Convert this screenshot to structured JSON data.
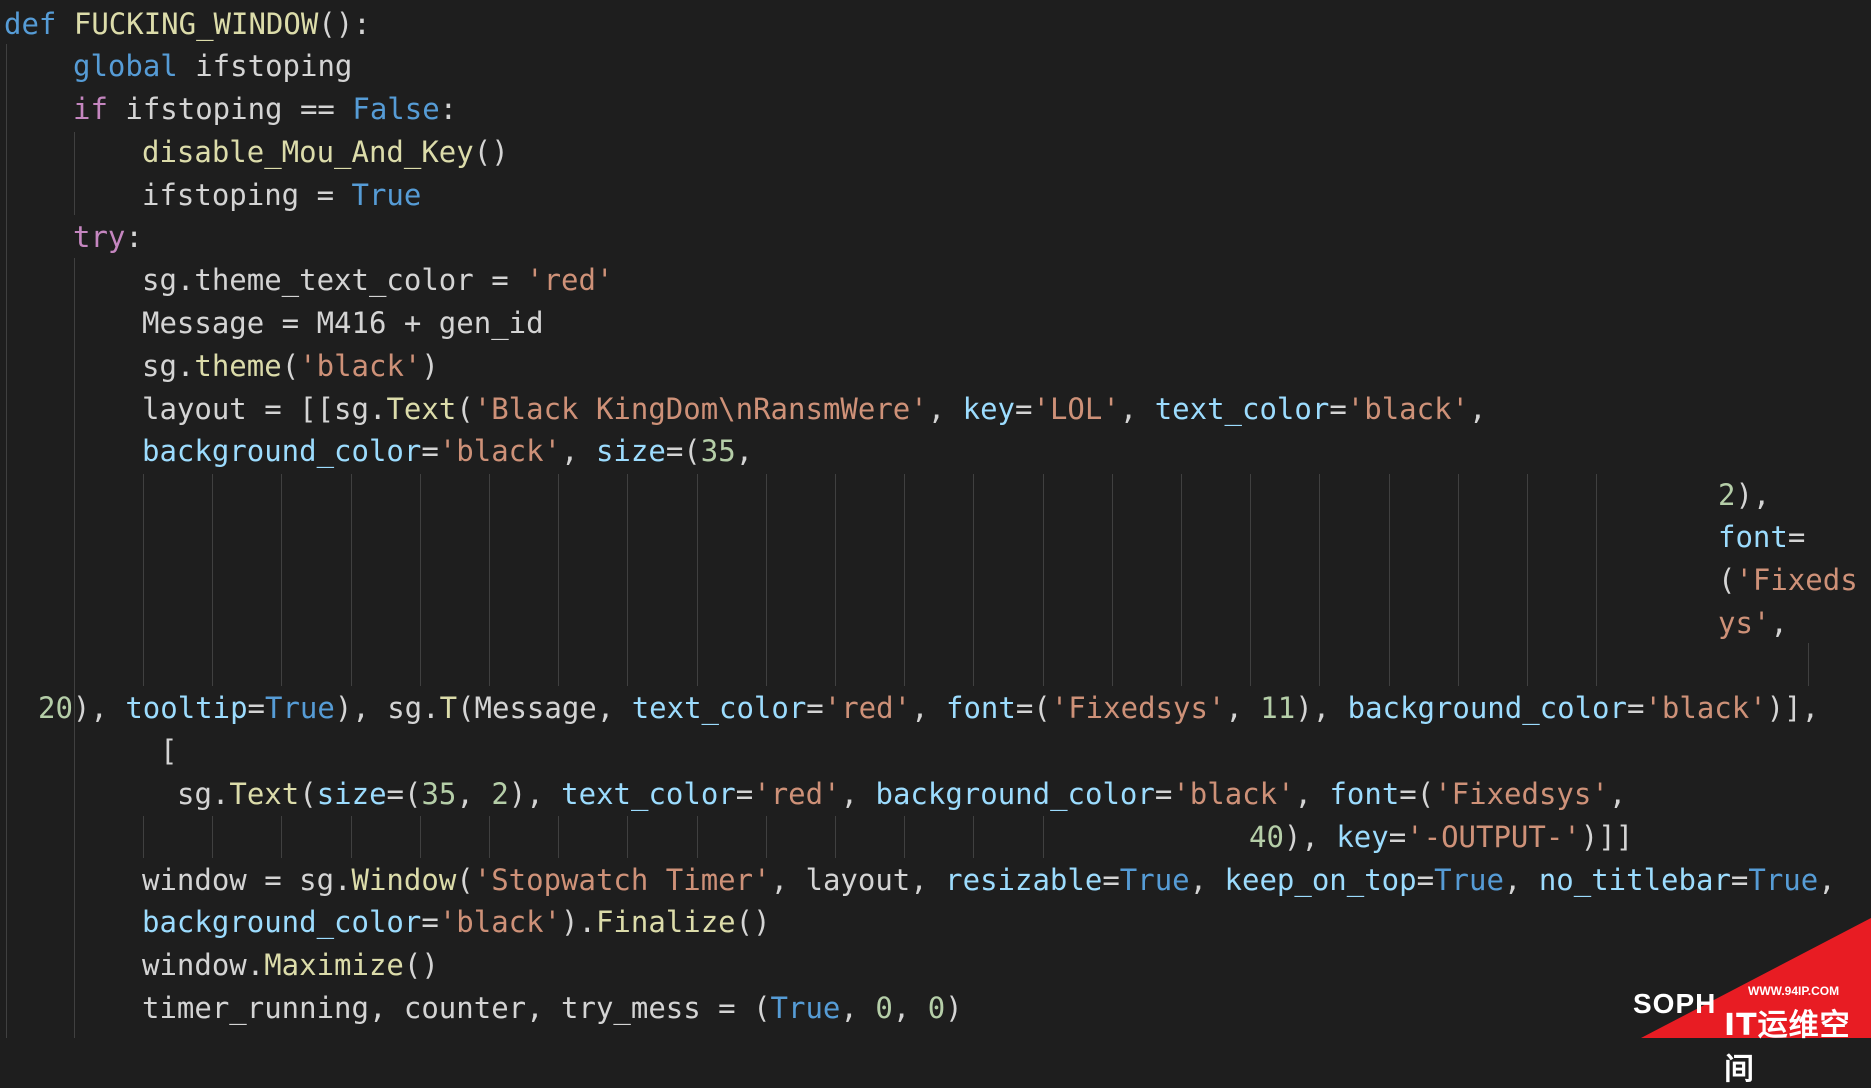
{
  "colors": {
    "background": "#1e1e1e",
    "keyword": "#569cd6",
    "control": "#c586c0",
    "function": "#dcdcaa",
    "string": "#ce9178",
    "number": "#b5cea8",
    "parameter": "#9cdcfe",
    "text": "#d4d4d4",
    "watermark": "#e81c23"
  },
  "code_lines": [
    [
      [
        "kw",
        "def"
      ],
      [
        "id",
        " "
      ],
      [
        "fn",
        "FUCKING_WINDOW"
      ],
      [
        "id",
        "():"
      ]
    ],
    [
      [
        "kw",
        "global"
      ],
      [
        "id",
        " ifstoping"
      ]
    ],
    [
      [
        "ctl",
        "if"
      ],
      [
        "id",
        " ifstoping == "
      ],
      [
        "kw",
        "False"
      ],
      [
        "id",
        ":"
      ]
    ],
    [
      [
        "fn",
        "disable_Mou_And_Key"
      ],
      [
        "id",
        "()"
      ]
    ],
    [
      [
        "id",
        "ifstoping = "
      ],
      [
        "kw",
        "True"
      ]
    ],
    [
      [
        "ctl",
        "try"
      ],
      [
        "id",
        ":"
      ]
    ],
    [
      [
        "id",
        "sg.theme_text_color = "
      ],
      [
        "str",
        "'red'"
      ]
    ],
    [
      [
        "id",
        "Message = M416 + gen_id"
      ]
    ],
    [
      [
        "id",
        "sg."
      ],
      [
        "fn",
        "theme"
      ],
      [
        "id",
        "("
      ],
      [
        "str",
        "'black'"
      ],
      [
        "id",
        ")"
      ]
    ],
    [
      [
        "id",
        "layout = [[sg."
      ],
      [
        "fn",
        "Text"
      ],
      [
        "id",
        "("
      ],
      [
        "str",
        "'Black KingDom\\nRansmWere'"
      ],
      [
        "id",
        ", "
      ],
      [
        "prm",
        "key"
      ],
      [
        "id",
        "="
      ],
      [
        "str",
        "'LOL'"
      ],
      [
        "id",
        ", "
      ],
      [
        "prm",
        "text_color"
      ],
      [
        "id",
        "="
      ],
      [
        "str",
        "'black'"
      ],
      [
        "id",
        ","
      ]
    ],
    [
      [
        "prm",
        "background_color"
      ],
      [
        "id",
        "="
      ],
      [
        "str",
        "'black'"
      ],
      [
        "id",
        ", "
      ],
      [
        "prm",
        "size"
      ],
      [
        "id",
        "=("
      ],
      [
        "num",
        "35"
      ],
      [
        "id",
        ","
      ]
    ],
    [
      [
        "num",
        "2"
      ],
      [
        "id",
        "),"
      ]
    ],
    [
      [
        "prm",
        "font"
      ],
      [
        "id",
        "="
      ]
    ],
    [
      [
        "id",
        "("
      ],
      [
        "str",
        "'Fixeds"
      ]
    ],
    [
      [
        "str",
        "ys'"
      ],
      [
        "id",
        ","
      ]
    ],
    [
      [
        "num",
        "20"
      ],
      [
        "id",
        "), "
      ],
      [
        "prm",
        "tooltip"
      ],
      [
        "id",
        "="
      ],
      [
        "kw",
        "True"
      ],
      [
        "id",
        "), sg."
      ],
      [
        "fn",
        "T"
      ],
      [
        "id",
        "(Message, "
      ],
      [
        "prm",
        "text_color"
      ],
      [
        "id",
        "="
      ],
      [
        "str",
        "'red'"
      ],
      [
        "id",
        ", "
      ],
      [
        "prm",
        "font"
      ],
      [
        "id",
        "=("
      ],
      [
        "str",
        "'Fixedsys'"
      ],
      [
        "id",
        ", "
      ],
      [
        "num",
        "11"
      ],
      [
        "id",
        "), "
      ],
      [
        "prm",
        "background_color"
      ],
      [
        "id",
        "="
      ],
      [
        "str",
        "'black'"
      ],
      [
        "id",
        ")],"
      ]
    ],
    [
      [
        "id",
        "["
      ]
    ],
    [
      [
        "id",
        "sg."
      ],
      [
        "fn",
        "Text"
      ],
      [
        "id",
        "("
      ],
      [
        "prm",
        "size"
      ],
      [
        "id",
        "=("
      ],
      [
        "num",
        "35"
      ],
      [
        "id",
        ", "
      ],
      [
        "num",
        "2"
      ],
      [
        "id",
        "), "
      ],
      [
        "prm",
        "text_color"
      ],
      [
        "id",
        "="
      ],
      [
        "str",
        "'red'"
      ],
      [
        "id",
        ", "
      ],
      [
        "prm",
        "background_color"
      ],
      [
        "id",
        "="
      ],
      [
        "str",
        "'black'"
      ],
      [
        "id",
        ", "
      ],
      [
        "prm",
        "font"
      ],
      [
        "id",
        "=("
      ],
      [
        "str",
        "'Fixedsys'"
      ],
      [
        "id",
        ","
      ]
    ],
    [
      [
        "num",
        "40"
      ],
      [
        "id",
        "), "
      ],
      [
        "prm",
        "key"
      ],
      [
        "id",
        "="
      ],
      [
        "str",
        "'-OUTPUT-'"
      ],
      [
        "id",
        ")]]"
      ]
    ],
    [
      [
        "id",
        "window = sg."
      ],
      [
        "fn",
        "Window"
      ],
      [
        "id",
        "("
      ],
      [
        "str",
        "'Stopwatch Timer'"
      ],
      [
        "id",
        ", layout, "
      ],
      [
        "prm",
        "resizable"
      ],
      [
        "id",
        "="
      ],
      [
        "kw",
        "True"
      ],
      [
        "id",
        ", "
      ],
      [
        "prm",
        "keep_on_top"
      ],
      [
        "id",
        "="
      ],
      [
        "kw",
        "True"
      ],
      [
        "id",
        ", "
      ],
      [
        "prm",
        "no_titlebar"
      ],
      [
        "id",
        "="
      ],
      [
        "kw",
        "True"
      ],
      [
        "id",
        ","
      ]
    ],
    [
      [
        "prm",
        "background_color"
      ],
      [
        "id",
        "="
      ],
      [
        "str",
        "'black'"
      ],
      [
        "id",
        ")."
      ],
      [
        "fn",
        "Finalize"
      ],
      [
        "id",
        "()"
      ]
    ],
    [
      [
        "id",
        "window."
      ],
      [
        "fn",
        "Maximize"
      ],
      [
        "id",
        "()"
      ]
    ],
    [
      [
        "id",
        "timer_running, counter, try_mess = ("
      ],
      [
        "kw",
        "True"
      ],
      [
        "id",
        ", "
      ],
      [
        "num",
        "0"
      ],
      [
        "id",
        ", "
      ],
      [
        "num",
        "0"
      ],
      [
        "id",
        ")"
      ]
    ]
  ],
  "watermark": {
    "brand": "SOPH",
    "url": "WWW.94IP.COM",
    "text": "IT运维空间"
  }
}
